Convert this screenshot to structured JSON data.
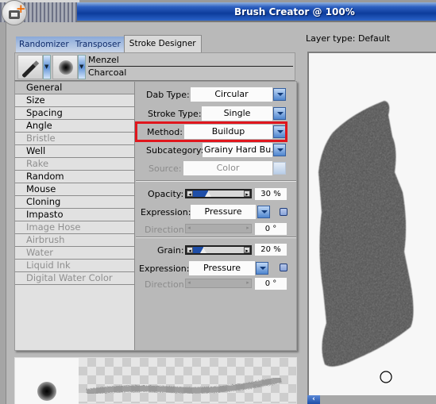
{
  "window": {
    "title": "Brush Creator @ 100%",
    "app_icon": "new-document-plus-icon"
  },
  "tabs": [
    {
      "label": "Randomizer",
      "active": false
    },
    {
      "label": "Transposer",
      "active": false
    },
    {
      "label": "Stroke Designer",
      "active": true
    }
  ],
  "brush": {
    "category": "Menzel",
    "variant": "Charcoal",
    "category_icon": "pen-icon",
    "dab_icon": "dab-preview-icon"
  },
  "categories": [
    {
      "label": "General",
      "enabled": true,
      "selected": true
    },
    {
      "label": "Size",
      "enabled": true
    },
    {
      "label": "Spacing",
      "enabled": true
    },
    {
      "label": "Angle",
      "enabled": true
    },
    {
      "label": "Bristle",
      "enabled": false
    },
    {
      "label": "Well",
      "enabled": true
    },
    {
      "label": "Rake",
      "enabled": false
    },
    {
      "label": "Random",
      "enabled": true
    },
    {
      "label": "Mouse",
      "enabled": true
    },
    {
      "label": "Cloning",
      "enabled": true
    },
    {
      "label": "Impasto",
      "enabled": true
    },
    {
      "label": "Image Hose",
      "enabled": false
    },
    {
      "label": "Airbrush",
      "enabled": false
    },
    {
      "label": "Water",
      "enabled": false
    },
    {
      "label": "Liquid Ink",
      "enabled": false
    },
    {
      "label": "Digital Water Color",
      "enabled": false
    }
  ],
  "general": {
    "dab_type": {
      "label": "Dab Type:",
      "value": "Circular"
    },
    "stroke_type": {
      "label": "Stroke Type:",
      "value": "Single"
    },
    "method": {
      "label": "Method:",
      "value": "Buildup",
      "highlighted": true
    },
    "subcategory": {
      "label": "Subcategory:",
      "value": "Grainy Hard Bu..."
    },
    "source": {
      "label": "Source:",
      "value": "Color",
      "enabled": false
    },
    "opacity": {
      "label": "Opacity:",
      "value_text": "30 %",
      "value_percent": 30,
      "expression": {
        "label": "Expression:",
        "value": "Pressure",
        "inverted": false
      },
      "direction": {
        "label": "Direction:",
        "value_text": "0 °",
        "enabled": false
      }
    },
    "grain": {
      "label": "Grain:",
      "value_text": "20 %",
      "value_percent": 20,
      "expression": {
        "label": "Expression:",
        "value": "Pressure",
        "inverted": false
      },
      "direction": {
        "label": "Direction:",
        "value_text": "0 °",
        "enabled": false
      }
    }
  },
  "preview": {
    "layer_type_label": "Layer type: Default"
  },
  "colors": {
    "title_bar": "#0d3c9c",
    "highlight_box": "#e0161d",
    "slider_fill": "#1e4ea8"
  }
}
